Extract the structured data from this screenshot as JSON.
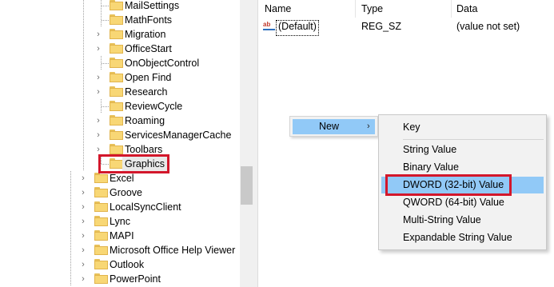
{
  "tree": {
    "items": [
      {
        "label": "MailSettings",
        "expandable": false
      },
      {
        "label": "MathFonts",
        "expandable": false
      },
      {
        "label": "Migration",
        "expandable": true
      },
      {
        "label": "OfficeStart",
        "expandable": true
      },
      {
        "label": "OnObjectControl",
        "expandable": false
      },
      {
        "label": "Open Find",
        "expandable": true
      },
      {
        "label": "Research",
        "expandable": true
      },
      {
        "label": "ReviewCycle",
        "expandable": false
      },
      {
        "label": "Roaming",
        "expandable": true
      },
      {
        "label": "ServicesManagerCache",
        "expandable": true
      },
      {
        "label": "Toolbars",
        "expandable": true
      },
      {
        "label": "Graphics",
        "expandable": false,
        "selected": true
      },
      {
        "label": "Excel",
        "expandable": true
      },
      {
        "label": "Groove",
        "expandable": true
      },
      {
        "label": "LocalSyncClient",
        "expandable": true
      },
      {
        "label": "Lync",
        "expandable": true
      },
      {
        "label": "MAPI",
        "expandable": true
      },
      {
        "label": "Microsoft Office Help Viewer",
        "expandable": true
      },
      {
        "label": "Outlook",
        "expandable": true
      },
      {
        "label": "PowerPoint",
        "expandable": true
      }
    ]
  },
  "values": {
    "headers": {
      "name": "Name",
      "type": "Type",
      "data": "Data"
    },
    "rows": [
      {
        "icon": "string-value-icon",
        "icon_text": "ab",
        "name": "(Default)",
        "type": "REG_SZ",
        "data": "(value not set)"
      }
    ]
  },
  "context_menu": {
    "new_label": "New",
    "submenu_arrow": "›",
    "submenu": [
      "Key",
      "String Value",
      "Binary Value",
      "DWORD (32-bit) Value",
      "QWORD (64-bit) Value",
      "Multi-String Value",
      "Expandable String Value"
    ],
    "highlighted_index": 3
  },
  "colors": {
    "highlight": "#91c9f7",
    "annotation_red": "#d3172b",
    "folder": "#f8d775"
  }
}
